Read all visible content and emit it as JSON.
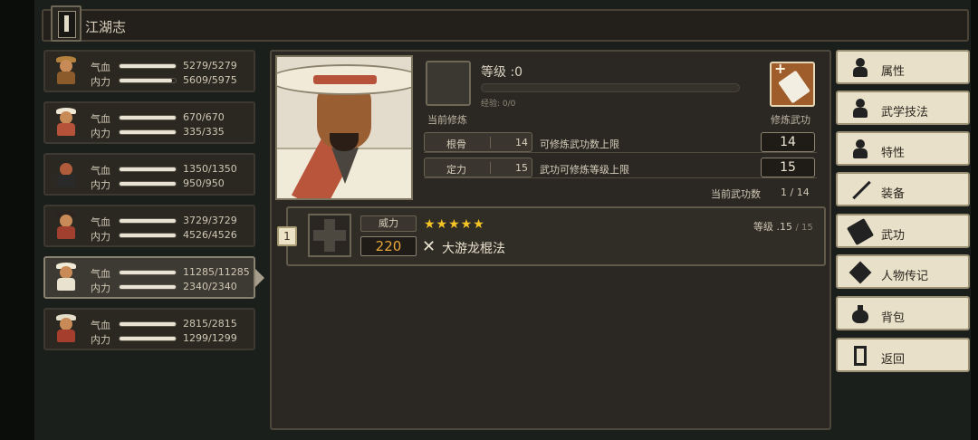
{
  "header": {
    "title": "江湖志"
  },
  "roster": [
    {
      "hp_label": "气血",
      "mp_label": "内力",
      "hp": "5279/5279",
      "mp": "5609/5975",
      "hp_frac": 1.0,
      "mp_frac": 0.94,
      "selected": false
    },
    {
      "hp_label": "气血",
      "mp_label": "内力",
      "hp": "670/670",
      "mp": "335/335",
      "hp_frac": 1.0,
      "mp_frac": 1.0,
      "selected": false
    },
    {
      "hp_label": "气血",
      "mp_label": "内力",
      "hp": "1350/1350",
      "mp": "950/950",
      "hp_frac": 1.0,
      "mp_frac": 1.0,
      "selected": false
    },
    {
      "hp_label": "气血",
      "mp_label": "内力",
      "hp": "3729/3729",
      "mp": "4526/4526",
      "hp_frac": 1.0,
      "mp_frac": 1.0,
      "selected": false
    },
    {
      "hp_label": "气血",
      "mp_label": "内力",
      "hp": "11285/11285",
      "mp": "2340/2340",
      "hp_frac": 1.0,
      "mp_frac": 1.0,
      "selected": true
    },
    {
      "hp_label": "气血",
      "mp_label": "内力",
      "hp": "2815/2815",
      "mp": "1299/1299",
      "hp_frac": 1.0,
      "mp_frac": 1.0,
      "selected": false
    }
  ],
  "cultivation": {
    "level_label": "等级 :0",
    "exp_text": "经验: 0/0",
    "current_label": "当前修炼",
    "cultivate_label": "修炼武功"
  },
  "attributes": [
    {
      "name": "根骨",
      "value": "14",
      "desc": "可修炼武功数上限",
      "box": "14"
    },
    {
      "name": "定力",
      "value": "15",
      "desc": "武功可修炼等级上限",
      "box": "15"
    }
  ],
  "martial_count": {
    "label": "当前武功数",
    "value": "1 / 14"
  },
  "skills": [
    {
      "index": "1",
      "power_tag": "威力",
      "stars": "★★★★★",
      "power": "220",
      "name": "大游龙棍法",
      "level": "等级 .15",
      "level_max": "/ 15"
    }
  ],
  "menu": [
    {
      "label": "属性",
      "icon": "person-icon"
    },
    {
      "label": "武学技法",
      "icon": "person-skill-icon"
    },
    {
      "label": "特性",
      "icon": "person-trait-icon"
    },
    {
      "label": "装备",
      "icon": "sword-icon"
    },
    {
      "label": "武功",
      "icon": "book-icon"
    },
    {
      "label": "人物传记",
      "icon": "diamond-icon"
    },
    {
      "label": "背包",
      "icon": "bag-icon"
    },
    {
      "label": "返回",
      "icon": "door-icon"
    }
  ],
  "colors": {
    "accent_orange": "#e7a53a",
    "star_yellow": "#f5c525",
    "menu_bg": "#e8e0c8",
    "panel_bg": "#2b2824"
  }
}
